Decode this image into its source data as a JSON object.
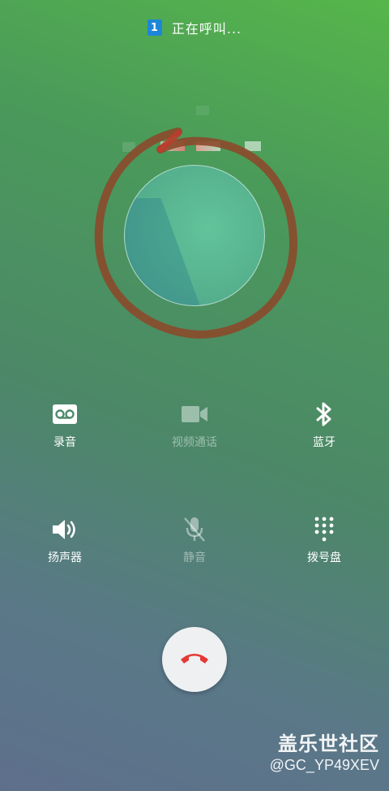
{
  "status": {
    "sim_slot": "1",
    "text": "正在呼叫..."
  },
  "actions_row1": [
    {
      "label": "录音",
      "icon": "voicemail-icon",
      "enabled": true
    },
    {
      "label": "视频通话",
      "icon": "video-camera-icon",
      "enabled": false
    },
    {
      "label": "蓝牙",
      "icon": "bluetooth-icon",
      "enabled": true
    }
  ],
  "actions_row2": [
    {
      "label": "扬声器",
      "icon": "speaker-icon",
      "enabled": true
    },
    {
      "label": "静音",
      "icon": "mute-mic-icon",
      "enabled": false
    },
    {
      "label": "拨号盘",
      "icon": "dialpad-icon",
      "enabled": true
    }
  ],
  "end_call": {
    "icon": "end-call-icon",
    "color": "#e53935"
  },
  "watermark": {
    "line1": "盖乐世社区",
    "line2": "@GC_YP49XEV"
  },
  "colors": {
    "annotation_circle": "#8b4a2b",
    "sim_badge": "#1d86d8"
  }
}
